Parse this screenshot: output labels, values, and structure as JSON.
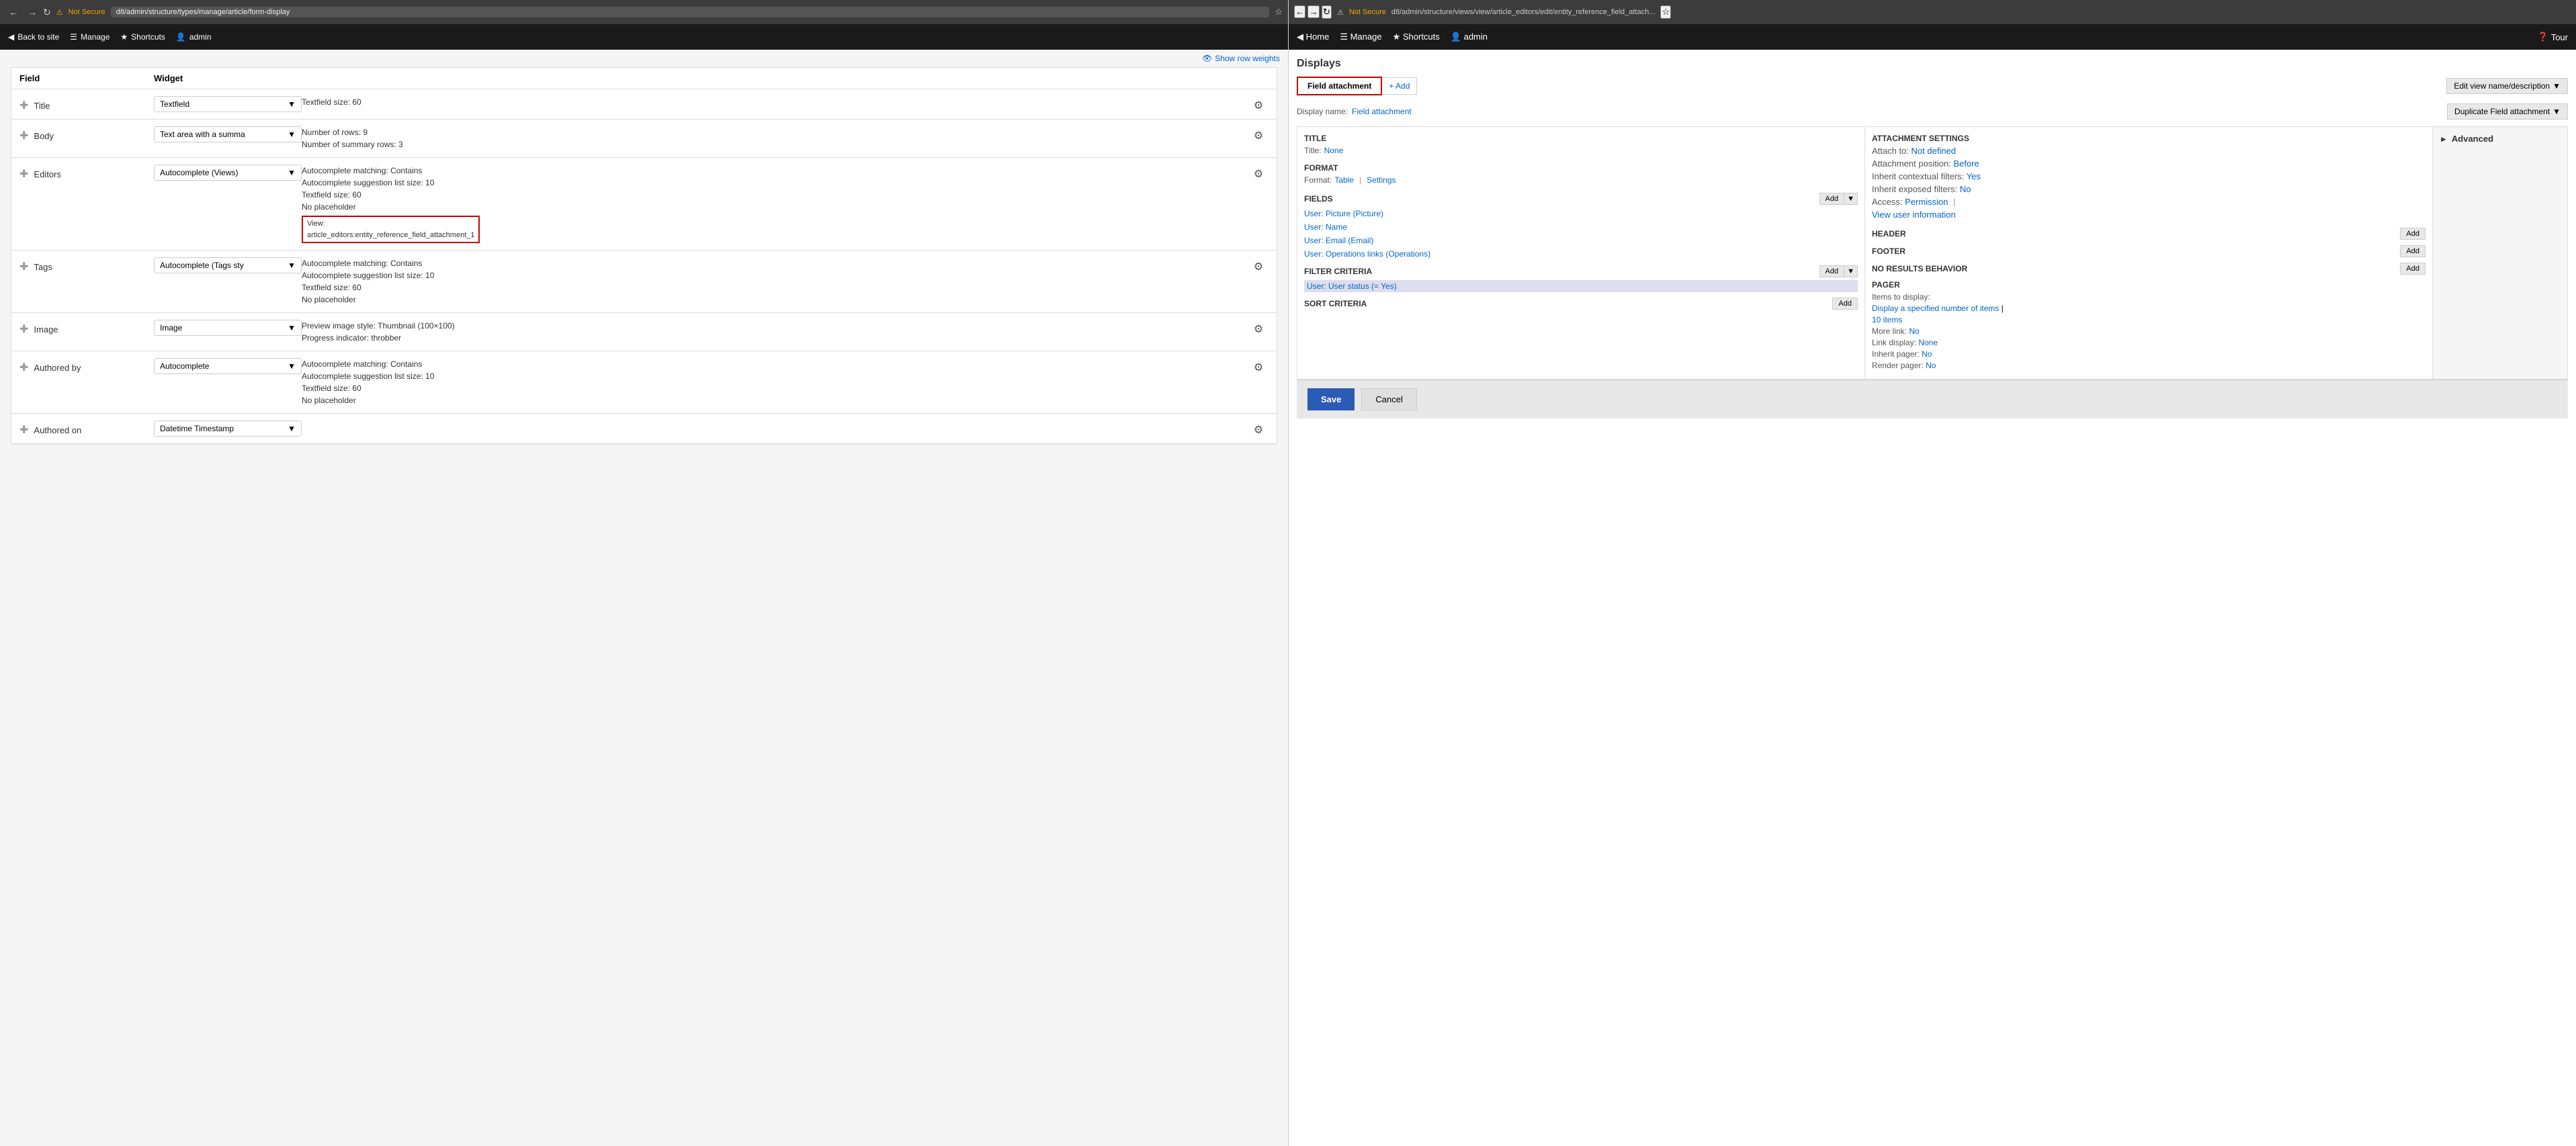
{
  "left": {
    "browser": {
      "url": "d8/admin/structure/types/manage/article/form-display",
      "lock_icon": "⚠",
      "lock_label": "Not Secure"
    },
    "admin_bar": {
      "back_label": "Back to site",
      "manage_label": "Manage",
      "shortcuts_label": "Shortcuts",
      "admin_label": "admin"
    },
    "show_row_weights": "Show row weights",
    "table": {
      "col_field": "Field",
      "col_widget": "Widget",
      "rows": [
        {
          "field": "Title",
          "widget": "Textfield",
          "info": "Textfield size: 60",
          "has_view": false
        },
        {
          "field": "Body",
          "widget": "Text area with a summa",
          "info": "Number of rows: 9\nNumber of summary rows: 3",
          "has_view": false
        },
        {
          "field": "Editors",
          "widget": "Autocomplete (Views)",
          "info": "Autocomplete matching: Contains\nAutocomplete suggestion list size: 10\nTextfield size: 60\nNo placeholder",
          "has_view": true,
          "view_label": "View:",
          "view_value": "article_editors:entity_reference_field_attachment_1"
        },
        {
          "field": "Tags",
          "widget": "Autocomplete (Tags sty",
          "info": "Autocomplete matching: Contains\nAutocomplete suggestion list size: 10\nTextfield size: 60\nNo placeholder",
          "has_view": false
        },
        {
          "field": "Image",
          "widget": "Image",
          "info": "Preview image style: Thumbnail (100×100)\nProgress indicator: throbber",
          "has_view": false
        },
        {
          "field": "Authored by",
          "widget": "Autocomplete",
          "info": "Autocomplete matching: Contains\nAutocomplete suggestion list size: 10\nTextfield size: 60\nNo placeholder",
          "has_view": false
        },
        {
          "field": "Authored on",
          "widget": "Datetime Timestamp",
          "info": "",
          "has_view": false
        }
      ]
    }
  },
  "right": {
    "browser": {
      "url": "d8/admin/structure/views/view/article_editors/edit/entity_reference_field_attach...",
      "lock_label": "Not Secure"
    },
    "admin_bar": {
      "home_label": "Home",
      "manage_label": "Manage",
      "shortcuts_label": "Shortcuts",
      "admin_label": "admin",
      "tour_label": "Tour"
    },
    "displays": {
      "title": "Displays",
      "active_tab": "Field attachment",
      "add_tab": "+ Add",
      "edit_view_btn": "Edit view name/description",
      "display_name_label": "Display name:",
      "display_name_value": "Field attachment",
      "dup_btn": "Duplicate Field attachment"
    },
    "title_section": {
      "label": "TITLE",
      "title_key": "Title:",
      "title_val": "None"
    },
    "format_section": {
      "label": "FORMAT",
      "format_key": "Format:",
      "format_val": "Table",
      "settings_link": "Settings"
    },
    "fields_section": {
      "label": "FIELDS",
      "add_btn": "Add",
      "items": [
        "User: Picture (Picture)",
        "User: Name",
        "User: Email (Email)",
        "User: Operations links (Operations)"
      ]
    },
    "filter_criteria": {
      "label": "FILTER CRITERIA",
      "add_btn": "Add",
      "items": [
        "User: User status (= Yes)"
      ]
    },
    "sort_criteria": {
      "label": "SORT CRITERIA",
      "add_btn": "Add",
      "items": []
    },
    "attachment_settings": {
      "title": "ATTACHMENT SETTINGS",
      "attach_key": "Attach to:",
      "attach_val": "Not defined",
      "position_key": "Attachment position:",
      "position_val": "Before",
      "inherit_contextual_key": "Inherit contextual filters:",
      "inherit_contextual_val": "Yes",
      "inherit_exposed_key": "Inherit exposed filters:",
      "inherit_exposed_val": "No",
      "access_key": "Access:",
      "access_val": "Permission",
      "view_user_link": "View user information"
    },
    "header": {
      "label": "HEADER",
      "add_btn": "Add"
    },
    "footer": {
      "label": "FOOTER",
      "add_btn": "Add"
    },
    "no_results": {
      "label": "NO RESULTS BEHAVIOR",
      "add_btn": "Add"
    },
    "pager": {
      "label": "PAGER",
      "items_label": "Items to display:",
      "items_link": "Display a specified number of items",
      "items_val": "10 items",
      "more_link_key": "More link:",
      "more_link_val": "No",
      "link_display_key": "Link display:",
      "link_display_val": "None",
      "inherit_pager_key": "Inherit pager:",
      "inherit_pager_val": "No",
      "render_pager_key": "Render pager:",
      "render_pager_val": "No"
    },
    "advanced": {
      "label": "Advanced"
    },
    "save_btn": "Save",
    "cancel_btn": "Cancel"
  }
}
